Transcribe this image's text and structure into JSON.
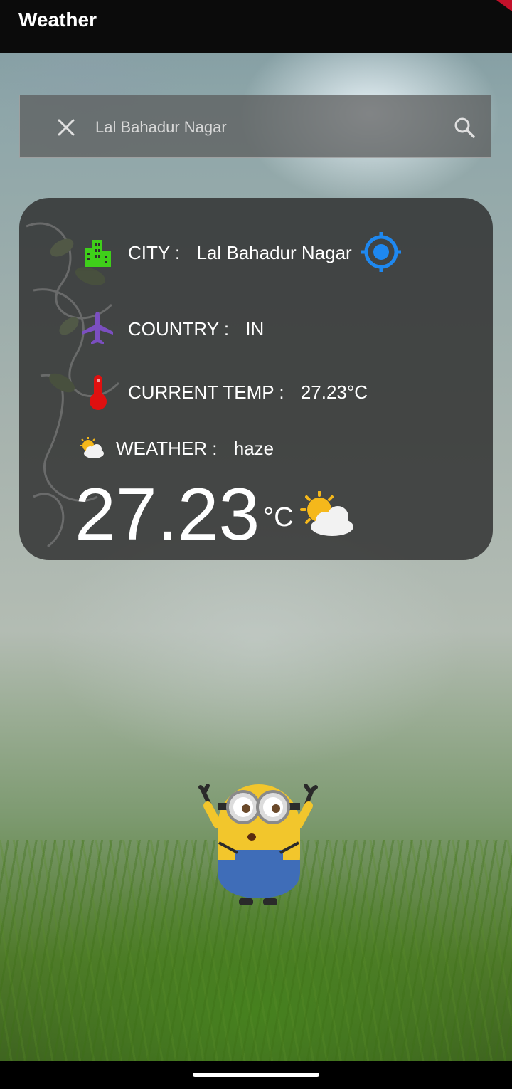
{
  "app": {
    "title": "Weather"
  },
  "search": {
    "value": "Lal Bahadur Nagar",
    "placeholder": ""
  },
  "card": {
    "city_label": "CITY :",
    "city_value": "Lal Bahadur Nagar",
    "country_label": "COUNTRY :",
    "country_value": "IN",
    "temp_label": "CURRENT TEMP :",
    "temp_value": "27.23°C",
    "weather_label": "WEATHER :",
    "weather_value": "haze",
    "big_temp": "27.23",
    "unit": "°C"
  },
  "icons": {
    "city": "building-icon",
    "locate": "gps-target-icon",
    "country": "airplane-icon",
    "temp": "thermometer-icon",
    "weather": "sun-behind-cloud-icon"
  },
  "colors": {
    "appbar": "#0b0b0b",
    "building": "#3fcf1a",
    "airplane": "#7b4fc0",
    "thermometer": "#e01010",
    "gps": "#1e88f0"
  }
}
